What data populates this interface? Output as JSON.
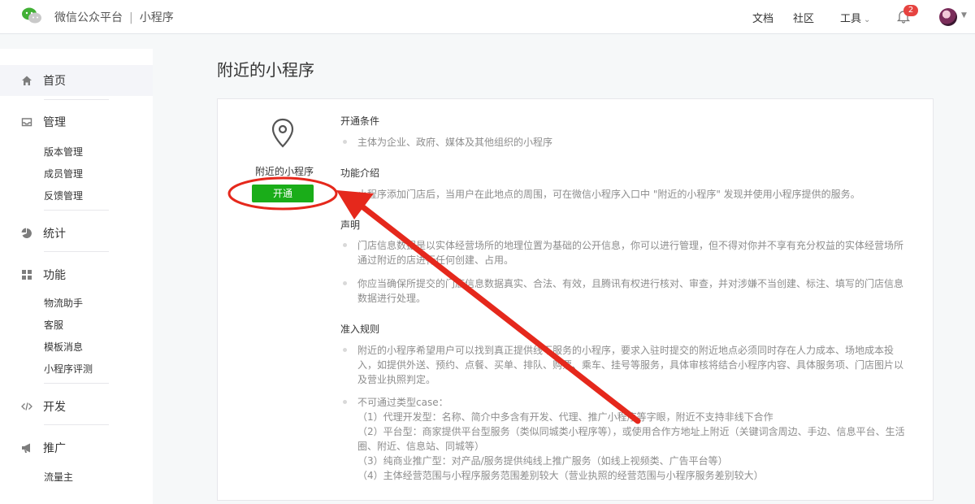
{
  "header": {
    "brand": "微信公众平台",
    "separator": "|",
    "product": "小程序",
    "nav": [
      "文档",
      "社区",
      "工具"
    ],
    "tools_caret": "⌄",
    "notification_count": "2"
  },
  "sidebar": {
    "home": "首页",
    "manage": {
      "label": "管理",
      "items": [
        "版本管理",
        "成员管理",
        "反馈管理"
      ]
    },
    "stats": "统计",
    "features": {
      "label": "功能",
      "items": [
        "物流助手",
        "客服",
        "模板消息",
        "小程序评测"
      ]
    },
    "develop": "开发",
    "promote": {
      "label": "推广",
      "items": [
        "流量主"
      ]
    }
  },
  "main": {
    "title": "附近的小程序",
    "plugin_name": "附近的小程序",
    "open_button": "开通",
    "sections": {
      "conditions": {
        "title": "开通条件",
        "text": "主体为企业、政府、媒体及其他组织的小程序"
      },
      "intro": {
        "title": "功能介绍",
        "text": "小程序添加门店后，当用户在此地点的周围，可在微信小程序入口中 \"附近的小程序\" 发现并使用小程序提供的服务。"
      },
      "statement": {
        "title": "声明",
        "p1": "门店信息数据是以实体经营场所的地理位置为基础的公开信息，你可以进行管理，但不得对你并不享有充分权益的实体经营场所通过附近的店进行任何创建、占用。",
        "p2": "你应当确保所提交的门店信息数据真实、合法、有效，且腾讯有权进行核对、审查，并对涉嫌不当创建、标注、填写的门店信息数据进行处理。"
      },
      "rules": {
        "title": "准入规则",
        "p1": "附近的小程序希望用户可以找到真正提供线下服务的小程序，要求入驻时提交的附近地点必须同时存在人力成本、场地成本投入，如提供外送、预约、点餐、买单、排队、购票、乘车、挂号等服务，具体审核将结合小程序内容、具体服务项、门店图片以及营业执照判定。",
        "case_title": "不可通过类型case：",
        "cases": [
          "（1）代理开发型：名称、简介中多含有开发、代理、推广小程序等字眼，附近不支持非线下合作",
          "（2）平台型：商家提供平台型服务（类似同城类小程序等），或使用合作方地址上附近（关键词含周边、手边、信息平台、生活",
          "圈、附近、信息站、同城等）",
          "（3）纯商业推广型：对产品/服务提供纯线上推广服务（如线上视频类、广告平台等）",
          "（4）主体经营范围与小程序服务范围差别较大（营业执照的经营范围与小程序服务差别较大）"
        ]
      }
    }
  },
  "colors": {
    "accent_green": "#1aad19",
    "annotation_red": "#e5281c",
    "badge_red": "#e64340"
  }
}
